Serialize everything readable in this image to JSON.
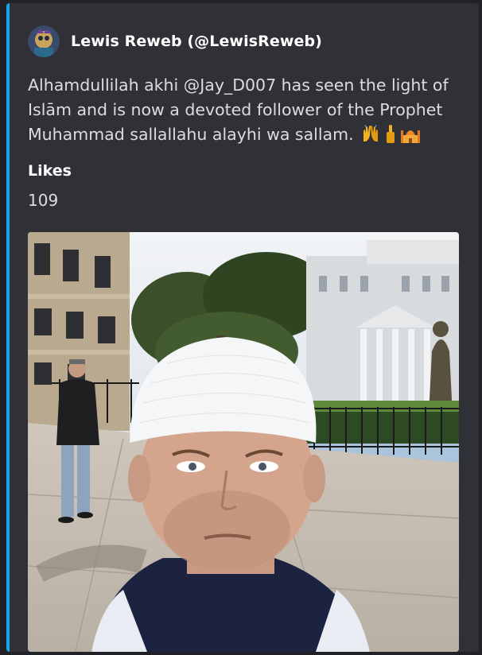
{
  "embed": {
    "accent_color": "#1da1f2",
    "author": {
      "name": "Lewis Reweb (@LewisReweb)"
    },
    "description": "Alhamdullilah akhi @Jay_D007 has seen the light of Islām and is now a devoted follower of the Prophet Muhammad sallallahu alayhi wa sallam.",
    "emoji": [
      "raised-hands",
      "person-raising-hand",
      "mosque"
    ],
    "field": {
      "name": "Likes",
      "value": "109"
    },
    "image": {
      "kind": "photo"
    }
  }
}
